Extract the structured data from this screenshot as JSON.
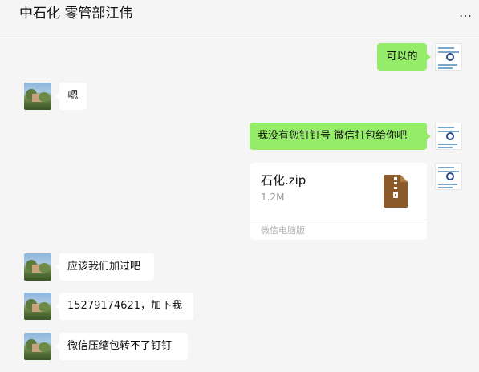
{
  "header": {
    "title": "中石化 零管部江伟",
    "more_icon": "…"
  },
  "messages": [
    {
      "from": "self",
      "type": "text",
      "text": "可以的"
    },
    {
      "from": "other",
      "type": "text",
      "text": "嗯"
    },
    {
      "from": "self",
      "type": "text",
      "text": "我没有您钉钉号 微信打包给你吧"
    },
    {
      "from": "self",
      "type": "file",
      "name": "石化.zip",
      "size": "1.2M",
      "source": "微信电脑版"
    },
    {
      "from": "other",
      "type": "text",
      "text": "应该我们加过吧"
    },
    {
      "from": "other",
      "type": "text",
      "text": "15279174621，加下我"
    },
    {
      "from": "other",
      "type": "text",
      "text": "微信压缩包转不了钉钉"
    }
  ],
  "colors": {
    "self_bubble": "#95ec69",
    "other_bubble": "#ffffff",
    "background": "#f5f5f5",
    "zip_icon": "#8a5a2b"
  }
}
